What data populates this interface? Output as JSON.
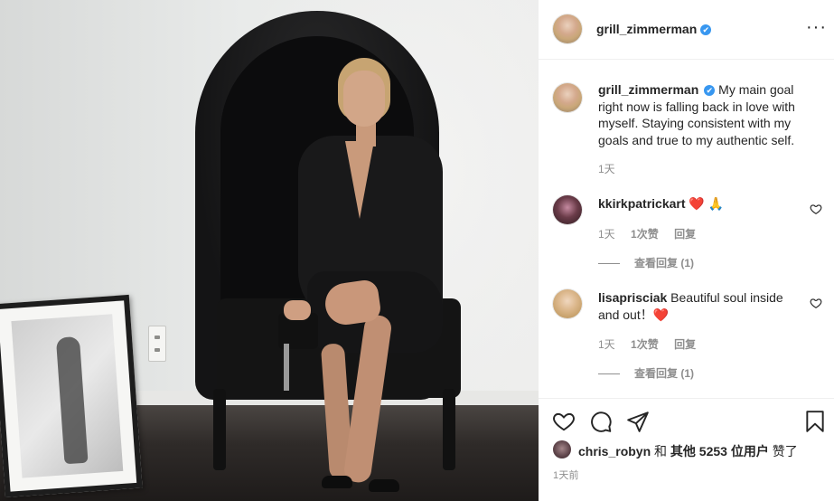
{
  "post": {
    "image_alt": "Woman in black dress seated on a black canopy chair beside a framed photo"
  },
  "header": {
    "username": "grill_zimmerman",
    "verified": "✔",
    "more": "···"
  },
  "caption": {
    "username": "grill_zimmerman",
    "verified": "✔",
    "text": "My main goal right now is falling back in love with myself. Staying consistent with my goals and true to my authentic self.",
    "time": "1天"
  },
  "comments": [
    {
      "username": "kkirkpatrickart",
      "text": "❤️ 🙏",
      "time": "1天",
      "likes": "1次赞",
      "reply": "回复",
      "view_replies": "查看回复 (1)"
    },
    {
      "username": "lisaprisciak",
      "text": "Beautiful soul inside and out！❤️",
      "time": "1天",
      "likes": "1次赞",
      "reply": "回复",
      "view_replies": "查看回复 (1)"
    }
  ],
  "likes": {
    "user": "chris_robyn",
    "and": "和",
    "others": "其他 5253 位用户",
    "liked": "赞了"
  },
  "post_time": "1天前",
  "colors": {
    "verified": "#3897f0",
    "secondary_text": "#8e8e8e",
    "heart": "#ed1c24"
  },
  "icons": [
    "heart-icon",
    "comment-icon",
    "share-icon",
    "bookmark-icon",
    "more-icon",
    "verified-icon"
  ]
}
